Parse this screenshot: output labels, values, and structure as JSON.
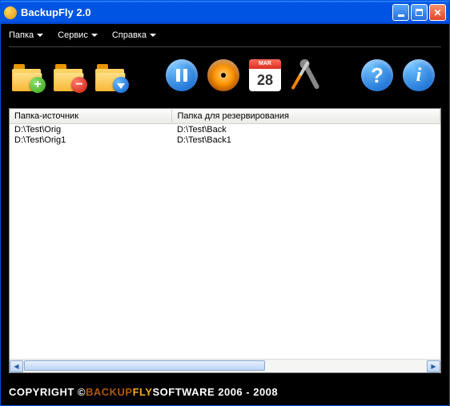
{
  "titlebar": {
    "title": "BackupFly 2.0"
  },
  "menu": {
    "folder": "Папка",
    "service": "Сервис",
    "help": "Справка"
  },
  "calendar": {
    "month": "MAR",
    "day": "28"
  },
  "icons": {
    "help_glyph": "?",
    "info_glyph": "i",
    "close_glyph": "✕",
    "badge_plus": "+",
    "badge_minus": "−",
    "scroll_left": "◀",
    "scroll_right": "▶"
  },
  "table": {
    "col_source": "Папка-источник",
    "col_dest": "Папка для резервирования",
    "rows": [
      {
        "source": "D:\\Test\\Orig",
        "dest": "D:\\Test\\Back"
      },
      {
        "source": "D:\\Test\\Orig1",
        "dest": "D:\\Test\\Back1"
      }
    ]
  },
  "footer": {
    "copyright": "COPYRIGHT © ",
    "brand1": "BACKUP",
    "brand2": "FLY",
    "rest": " SOFTWARE 2006 - 2008"
  }
}
